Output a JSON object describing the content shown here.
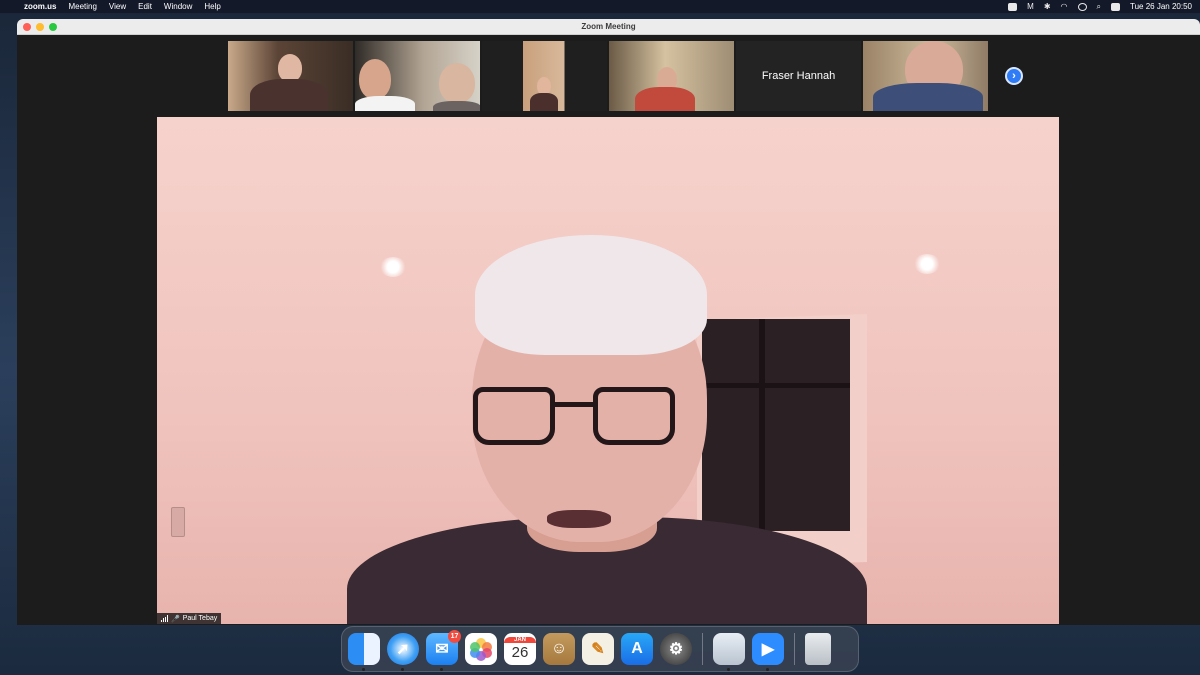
{
  "menubar": {
    "app_name": "zoom.us",
    "menus": [
      "Meeting",
      "View",
      "Edit",
      "Window",
      "Help"
    ],
    "clock": "Tue 26 Jan  20:50"
  },
  "window": {
    "title": "Zoom Meeting"
  },
  "gallery": {
    "name_only_participant": "Fraser Hannah",
    "next_icon": "chevron-right-icon"
  },
  "speaker": {
    "name": "Paul Tebay"
  },
  "dock": {
    "mail_badge": "17",
    "calendar_month": "JAN",
    "calendar_day": "26"
  },
  "colors": {
    "zoom_blue": "#2d8cff",
    "badge_red": "#f24b3f"
  }
}
